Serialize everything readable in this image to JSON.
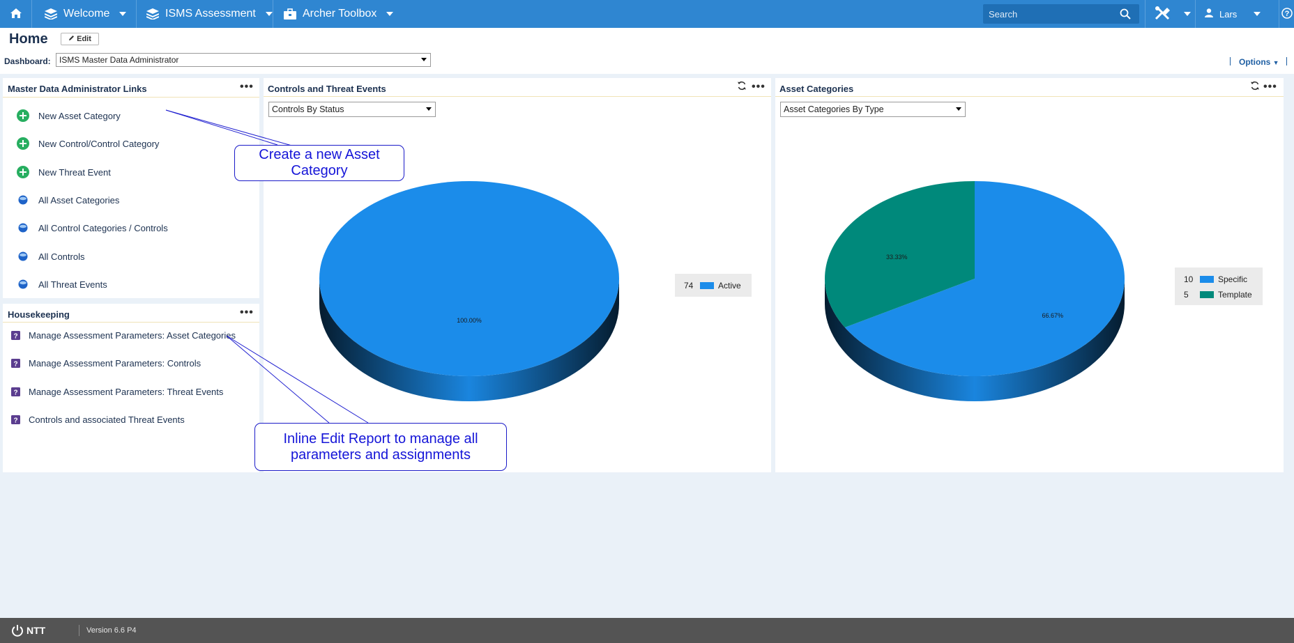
{
  "nav": {
    "welcome": "Welcome",
    "isms": "ISMS Assessment",
    "toolbox": "Archer Toolbox",
    "search_placeholder": "Search",
    "user": "Lars"
  },
  "header": {
    "title": "Home",
    "edit_label": "Edit",
    "dashboard_label": "Dashboard:",
    "dashboard_value": "ISMS Master Data Administrator",
    "options_label": "Options"
  },
  "links_panel": {
    "title": "Master Data Administrator Links",
    "items": [
      {
        "label": "New Asset Category",
        "icon": "add-icon"
      },
      {
        "label": "New Control/Control Category",
        "icon": "add-icon"
      },
      {
        "label": "New Threat Event",
        "icon": "add-icon"
      },
      {
        "label": "All Asset Categories",
        "icon": "globe-icon"
      },
      {
        "label": "All Control Categories / Controls",
        "icon": "globe-icon"
      },
      {
        "label": "All Controls",
        "icon": "globe-icon"
      },
      {
        "label": "All Threat Events",
        "icon": "globe-icon"
      }
    ]
  },
  "housekeeping_panel": {
    "title": "Housekeeping",
    "items": [
      {
        "label": "Manage Assessment Parameters: Asset Categories",
        "icon": "report-icon"
      },
      {
        "label": "Manage Assessment Parameters: Controls",
        "icon": "report-icon"
      },
      {
        "label": "Manage Assessment Parameters: Threat Events",
        "icon": "report-icon"
      },
      {
        "label": "Controls and associated Threat Events",
        "icon": "report-icon"
      }
    ]
  },
  "controls_panel": {
    "title": "Controls and Threat Events",
    "select_value": "Controls By Status"
  },
  "asset_panel": {
    "title": "Asset Categories",
    "select_value": "Asset Categories By Type"
  },
  "chart_data": [
    {
      "type": "pie",
      "title": "",
      "labels": [
        "Active"
      ],
      "values": [
        74
      ],
      "percent_labels": [
        "100.00%"
      ],
      "colors": [
        "#1b8cea"
      ],
      "legend": "right"
    },
    {
      "type": "pie",
      "title": "",
      "labels": [
        "Specific",
        "Template"
      ],
      "values": [
        10,
        5
      ],
      "percent_labels": [
        "66.67%",
        "33.33%"
      ],
      "colors": [
        "#1b8cea",
        "#00897b"
      ],
      "legend": "right"
    }
  ],
  "callouts": {
    "asset_category": "Create a new Asset Category",
    "inline_edit": "Inline Edit Report to manage all parameters and assignments"
  },
  "footer": {
    "logo": "NTT",
    "version": "Version 6.6 P4"
  },
  "colors": {
    "nav": "#2f86d1",
    "background": "#eaf1f8",
    "active": "#1b8cea",
    "template": "#00897b",
    "callout": "#1515d8"
  }
}
